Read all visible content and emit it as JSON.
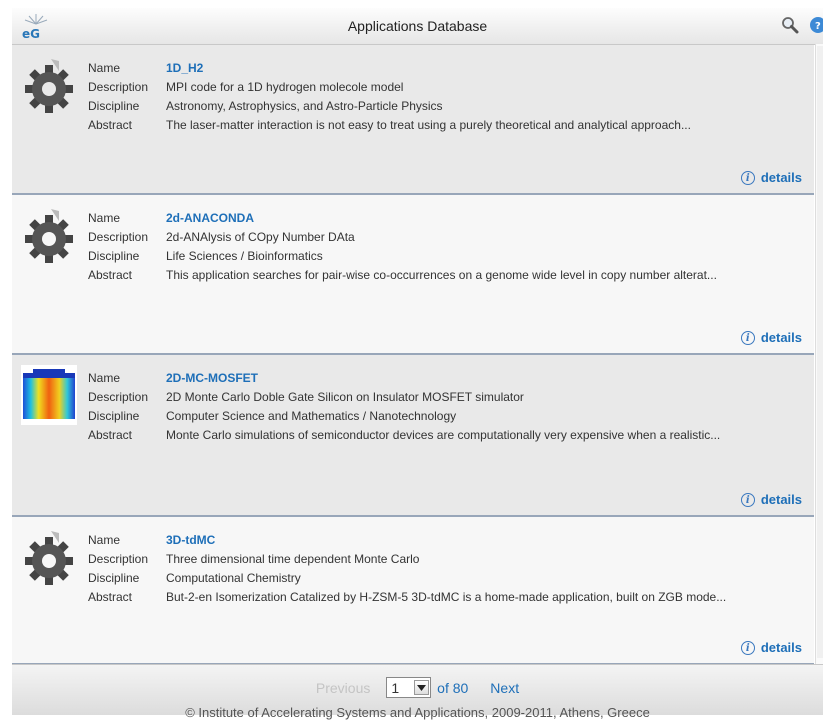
{
  "header": {
    "title": "Applications Database"
  },
  "labels": {
    "name": "Name",
    "description": "Description",
    "discipline": "Discipline",
    "abstract": "Abstract",
    "details": "details"
  },
  "items": [
    {
      "name": "1D_H2",
      "description": "MPI code for a 1D hydrogen molecole model",
      "discipline": "Astronomy, Astrophysics, and Astro-Particle Physics",
      "abstract": "The laser-matter interaction is not easy to treat using a purely theoretical and analytical approach...",
      "icon": "gear-icon"
    },
    {
      "name": "2d-ANACONDA",
      "description": "2d-ANAlysis of COpy Number DAta",
      "discipline": "Life Sciences / Bioinformatics",
      "abstract": "This application searches for pair-wise co-occurrences on a genome wide level in copy number alterat...",
      "icon": "gear-icon"
    },
    {
      "name": "2D-MC-MOSFET",
      "description": "2D Monte Carlo Doble Gate Silicon on Insulator MOSFET simulator",
      "discipline": "Computer Science and Mathematics / Nanotechnology",
      "abstract": "Monte Carlo simulations of semiconductor devices are computationally very expensive when a realistic...",
      "icon": "heatmap-thumbnail"
    },
    {
      "name": "3D-tdMC",
      "description": "Three dimensional time dependent Monte Carlo",
      "discipline": "Computational Chemistry",
      "abstract": "But-2-en Isomerization Catalized by H-ZSM-5 3D-tdMC is a home-made application, built on ZGB mode...",
      "icon": "gear-icon"
    }
  ],
  "pager": {
    "previous": "Previous",
    "page": "1",
    "of": "of 80",
    "next": "Next"
  },
  "footer": {
    "copyright": "© Institute of Accelerating Systems and Applications, 2009-2011, Athens, Greece"
  },
  "colors": {
    "link": "#1e6fb8",
    "separator": "#98a6b9",
    "row_odd": "#e9e9e9",
    "row_even": "#f7f7f7"
  }
}
